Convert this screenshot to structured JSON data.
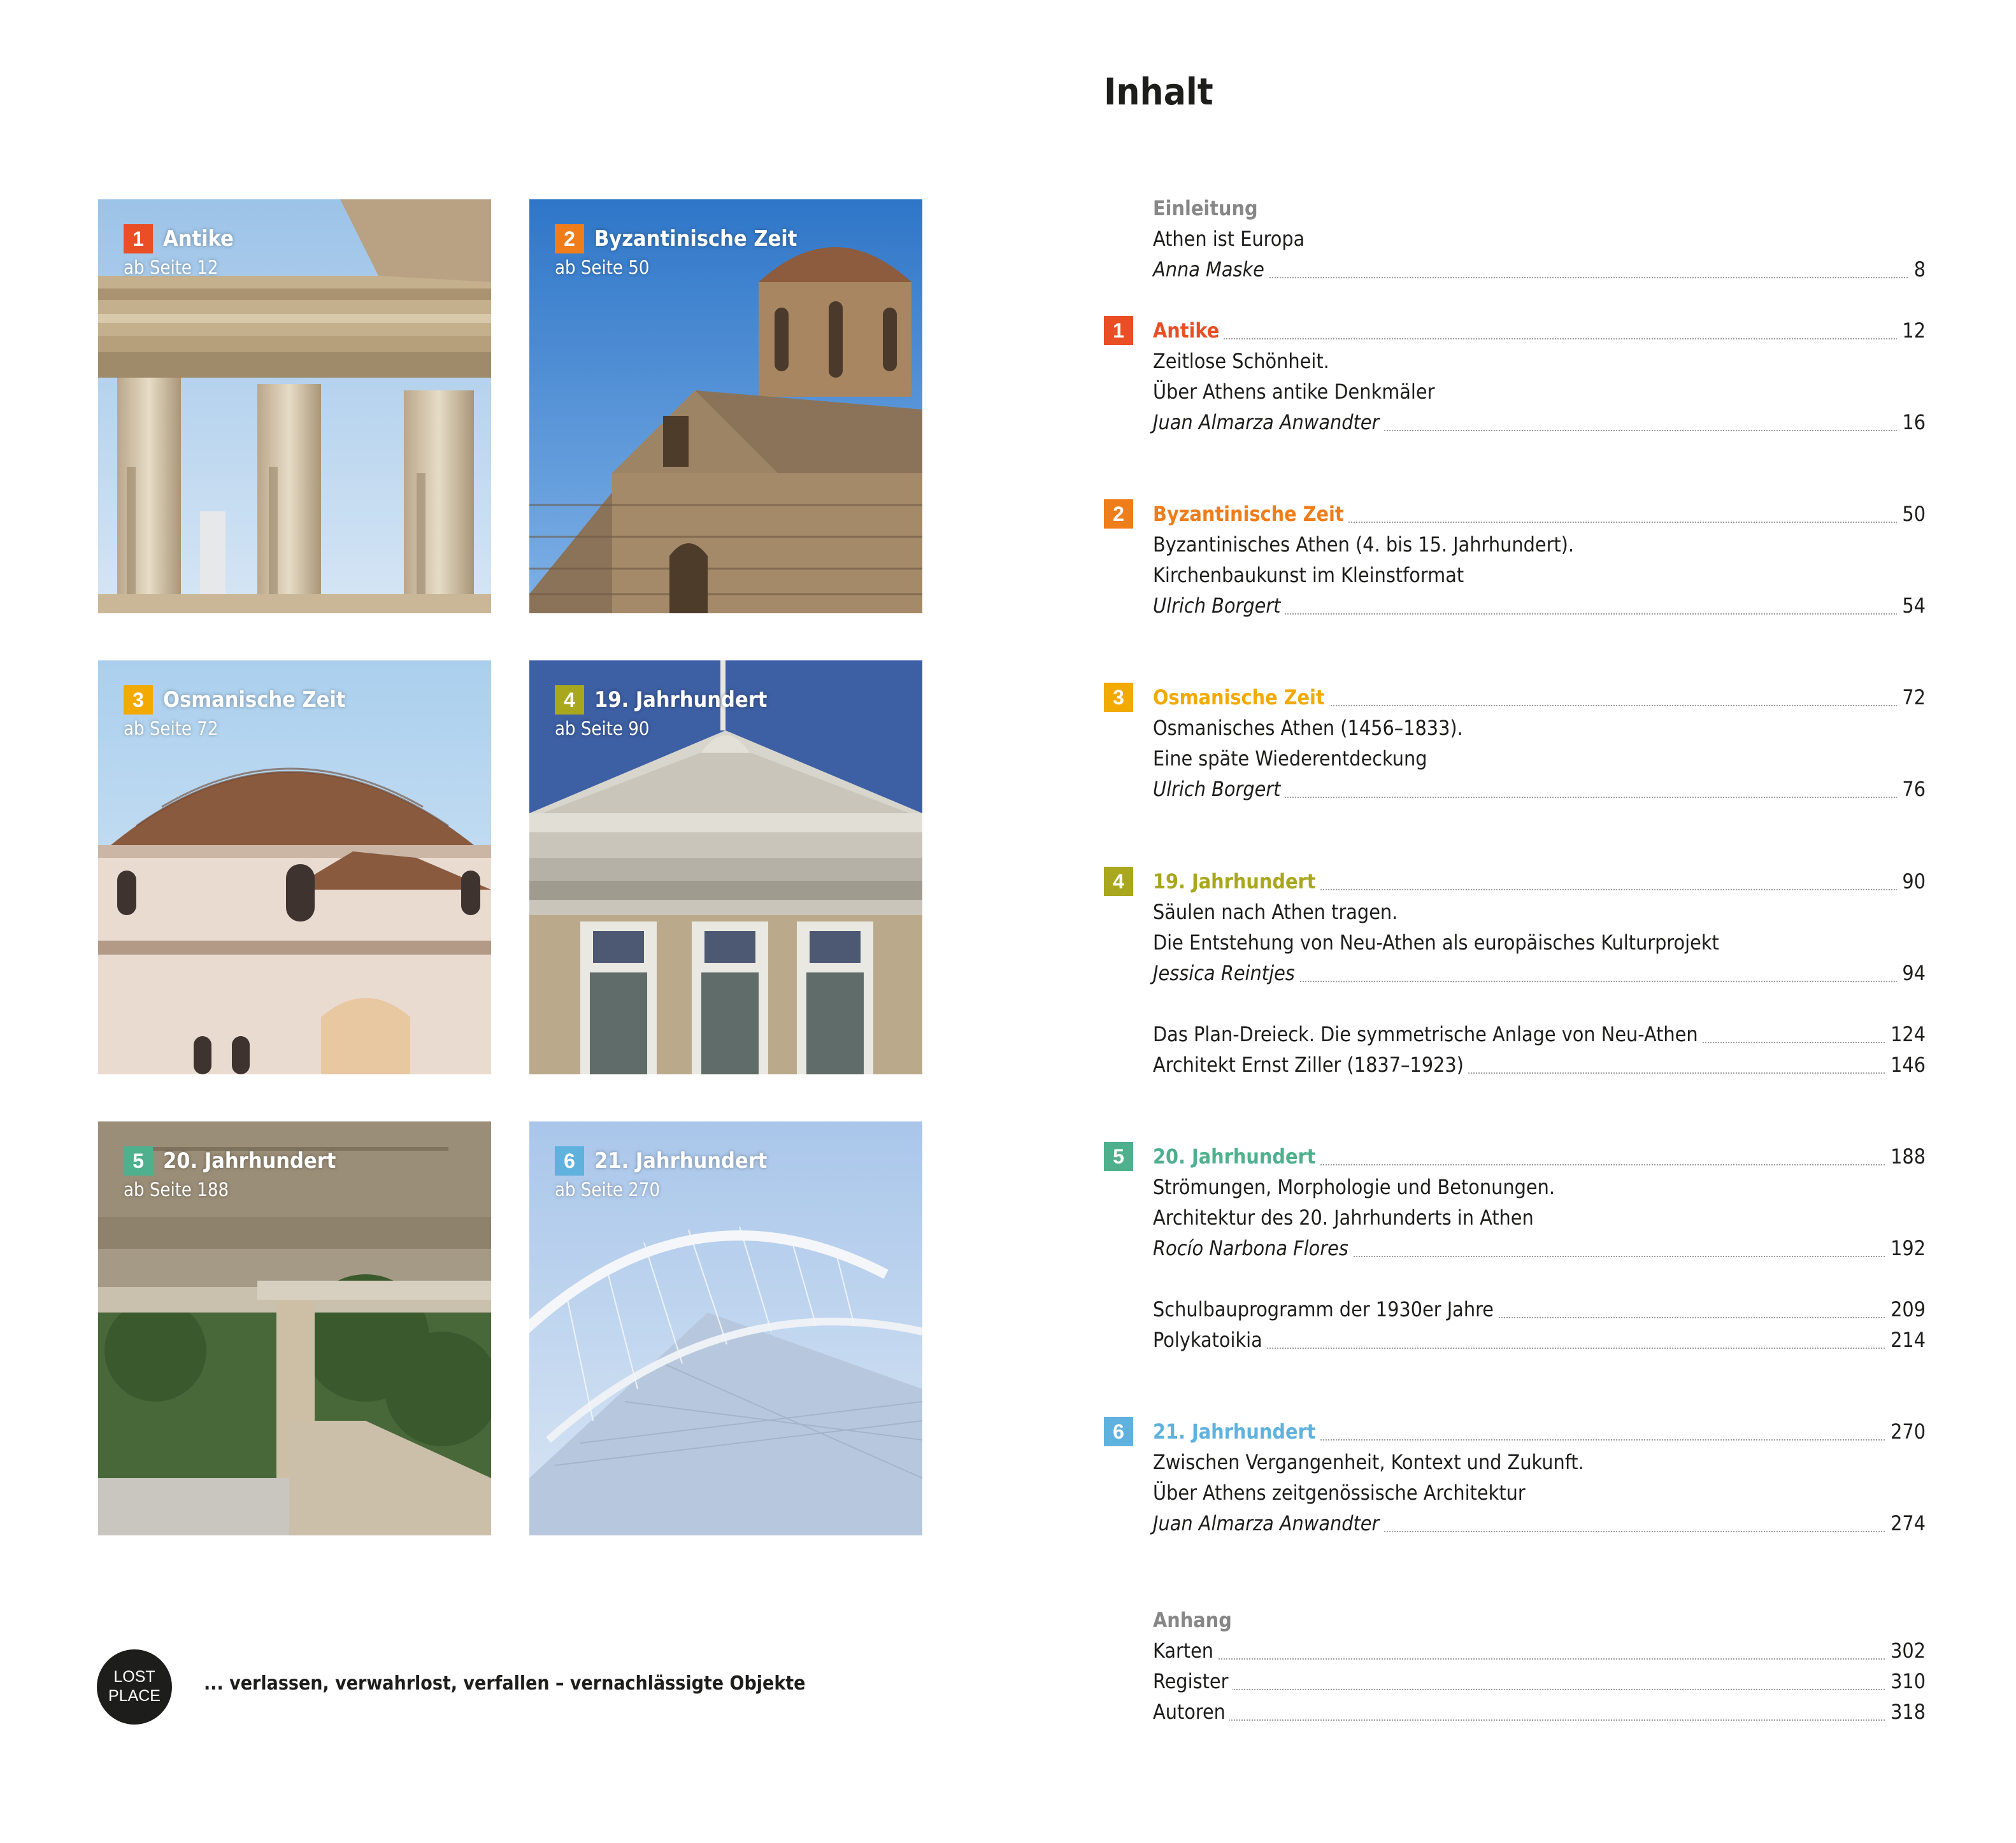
{
  "tiles": [
    {
      "num": "1",
      "title": "Antike",
      "sub": "ab Seite 12",
      "color": "#e94e24"
    },
    {
      "num": "2",
      "title": "Byzantinische Zeit",
      "sub": "ab Seite 50",
      "color": "#ef7d1a"
    },
    {
      "num": "3",
      "title": "Osmanische Zeit",
      "sub": "ab Seite 72",
      "color": "#f2a900"
    },
    {
      "num": "4",
      "title": "19. Jahrhundert",
      "sub": "ab Seite 90",
      "color": "#a8a71d"
    },
    {
      "num": "5",
      "title": "20. Jahrhundert",
      "sub": "ab Seite 188",
      "color": "#4fb08e"
    },
    {
      "num": "6",
      "title": "21. Jahrhundert",
      "sub": "ab Seite 270",
      "color": "#5fb2de"
    }
  ],
  "lost_place": {
    "badge_line1": "LOST",
    "badge_line2": "PLACE",
    "text": "... verlassen, verwahrlost, verfallen – vernachlässigte Objekte"
  },
  "toc": {
    "title": "Inhalt",
    "intro": {
      "heading": "Einleitung",
      "line1": "Athen ist Europa",
      "author": "Anna Maske",
      "page": "8"
    },
    "sections": [
      {
        "num": "1",
        "title": "Antike",
        "page": "12",
        "color": "#e94e24",
        "lines": [
          "Zeitlose Schönheit.",
          "Über Athens antike Denkmäler"
        ],
        "author": "Juan Almarza Anwandter",
        "author_page": "16"
      },
      {
        "num": "2",
        "title": "Byzantinische Zeit",
        "page": "50",
        "color": "#ef7d1a",
        "lines": [
          "Byzantinisches Athen (4. bis 15. Jahrhundert).",
          "Kirchenbaukunst im Kleinstformat"
        ],
        "author": "Ulrich Borgert",
        "author_page": "54"
      },
      {
        "num": "3",
        "title": "Osmanische Zeit",
        "page": "72",
        "color": "#f2a900",
        "lines": [
          "Osmanisches Athen (1456–1833).",
          "Eine späte Wiederentdeckung"
        ],
        "author": "Ulrich Borgert",
        "author_page": "76"
      },
      {
        "num": "4",
        "title": "19. Jahrhundert",
        "page": "90",
        "color": "#a8a71d",
        "lines": [
          "Säulen nach Athen tragen.",
          "Die Entstehung von Neu-Athen als europäisches Kulturprojekt"
        ],
        "author": "Jessica Reintjes",
        "author_page": "94",
        "extra": [
          {
            "text": "Das Plan-Dreieck. Die symmetrische Anlage von Neu-Athen",
            "page": "124"
          },
          {
            "text": "Architekt Ernst Ziller (1837–1923)",
            "page": "146"
          }
        ]
      },
      {
        "num": "5",
        "title": "20. Jahrhundert",
        "page": "188",
        "color": "#4fb08e",
        "lines": [
          "Strömungen, Morphologie und Betonungen.",
          "Architektur des 20. Jahrhunderts in Athen"
        ],
        "author": "Rocío Narbona Flores",
        "author_page": "192",
        "extra": [
          {
            "text": "Schulbauprogramm der 1930er Jahre",
            "page": "209"
          },
          {
            "text": "Polykatoikia",
            "page": "214"
          }
        ]
      },
      {
        "num": "6",
        "title": "21. Jahrhundert",
        "page": "270",
        "color": "#5fb2de",
        "lines": [
          "Zwischen Vergangenheit, Kontext und Zukunft.",
          "Über Athens zeitgenössische Architektur"
        ],
        "author": "Juan Almarza Anwandter",
        "author_page": "274"
      }
    ],
    "appendix": {
      "heading": "Anhang",
      "items": [
        {
          "text": "Karten",
          "page": "302"
        },
        {
          "text": "Register",
          "page": "310"
        },
        {
          "text": "Autoren",
          "page": "318"
        }
      ]
    }
  }
}
